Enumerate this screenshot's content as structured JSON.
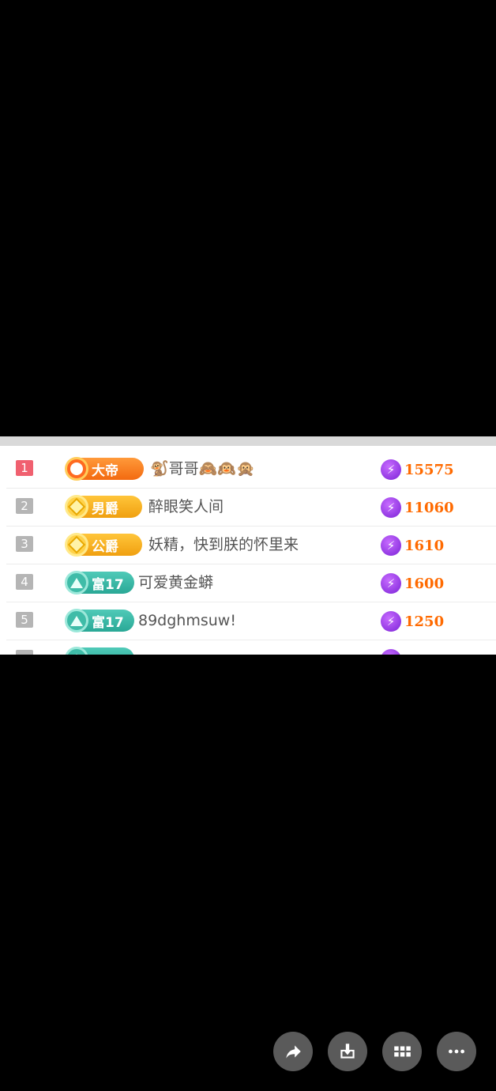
{
  "leaderboard": {
    "rows": [
      {
        "rank": "1",
        "badge_label": "大帝",
        "badge_type": "emperor",
        "name": "🐒哥哥🙈🙉🙊",
        "score": "15575"
      },
      {
        "rank": "2",
        "badge_label": "男爵",
        "badge_type": "gold",
        "name": "醉眼笑人间",
        "score": "11060"
      },
      {
        "rank": "3",
        "badge_label": "公爵",
        "badge_type": "gold",
        "name": "妖精，快到朕的怀里来",
        "score": "1610"
      },
      {
        "rank": "4",
        "badge_label": "富17",
        "badge_type": "green",
        "name": "可爱黄金蟒",
        "score": "1600"
      },
      {
        "rank": "5",
        "badge_label": "富17",
        "badge_type": "green",
        "name": "89dghmsuw!",
        "score": "1250"
      }
    ]
  },
  "actions": {
    "share_icon": "share-arrow-icon",
    "download_icon": "download-icon",
    "grid_icon": "grid-icon",
    "more_icon": "more-dots-icon"
  },
  "colors": {
    "rank_first": "#f0606f",
    "rank_other": "#b5b5b5",
    "score": "#ff6a00",
    "energy": "#7a22d6"
  }
}
